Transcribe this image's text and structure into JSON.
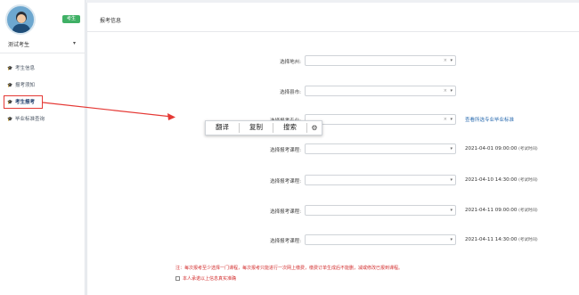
{
  "sidebar": {
    "role_badge": "考生",
    "user_name": "测试考生",
    "user_caret": "▾",
    "items": [
      {
        "label": "考生信息",
        "icon": "graduation-cap-icon"
      },
      {
        "label": "报考须知",
        "icon": "graduation-cap-icon"
      },
      {
        "label": "考生报考",
        "icon": "graduation-cap-icon",
        "active": true
      },
      {
        "label": "毕业标准查询",
        "icon": "graduation-cap-icon"
      }
    ]
  },
  "main": {
    "title": "报考信息",
    "fields": {
      "region_label": "选择地州:",
      "city_label": "选择县市:",
      "major_label": "选择报考专业:",
      "major_link": "查看所选专业毕业标准",
      "course_label": "选择报考课程:"
    },
    "courses": [
      {
        "label": "选择报考课程:",
        "date": "2021-04-01 09:00:00",
        "note": "(考试时间)"
      },
      {
        "label": "选择报考课程:",
        "date": "2021-04-10 14:30:00",
        "note": "(考试时间)"
      },
      {
        "label": "选择报考课程:",
        "date": "2021-04-11 09:00:00",
        "note": "(考试时间)"
      },
      {
        "label": "选择报考课程:",
        "date": "2021-04-11 14:30:00",
        "note": "(考试时间)"
      }
    ],
    "notice": "注：每次报考至少选择一门课程，每次报考只能进行一次网上缴费，缴费订单生成后不能删，减或修改已报到课程。",
    "agree_text": "本人承诺以上信息真实准确"
  },
  "toolbar": {
    "translate": "翻译",
    "copy": "复制",
    "search": "搜索",
    "settings_icon": "gear-icon"
  },
  "colors": {
    "accent_red": "#e53935",
    "badge_green": "#3fb065",
    "link_blue": "#2b6cb0"
  }
}
